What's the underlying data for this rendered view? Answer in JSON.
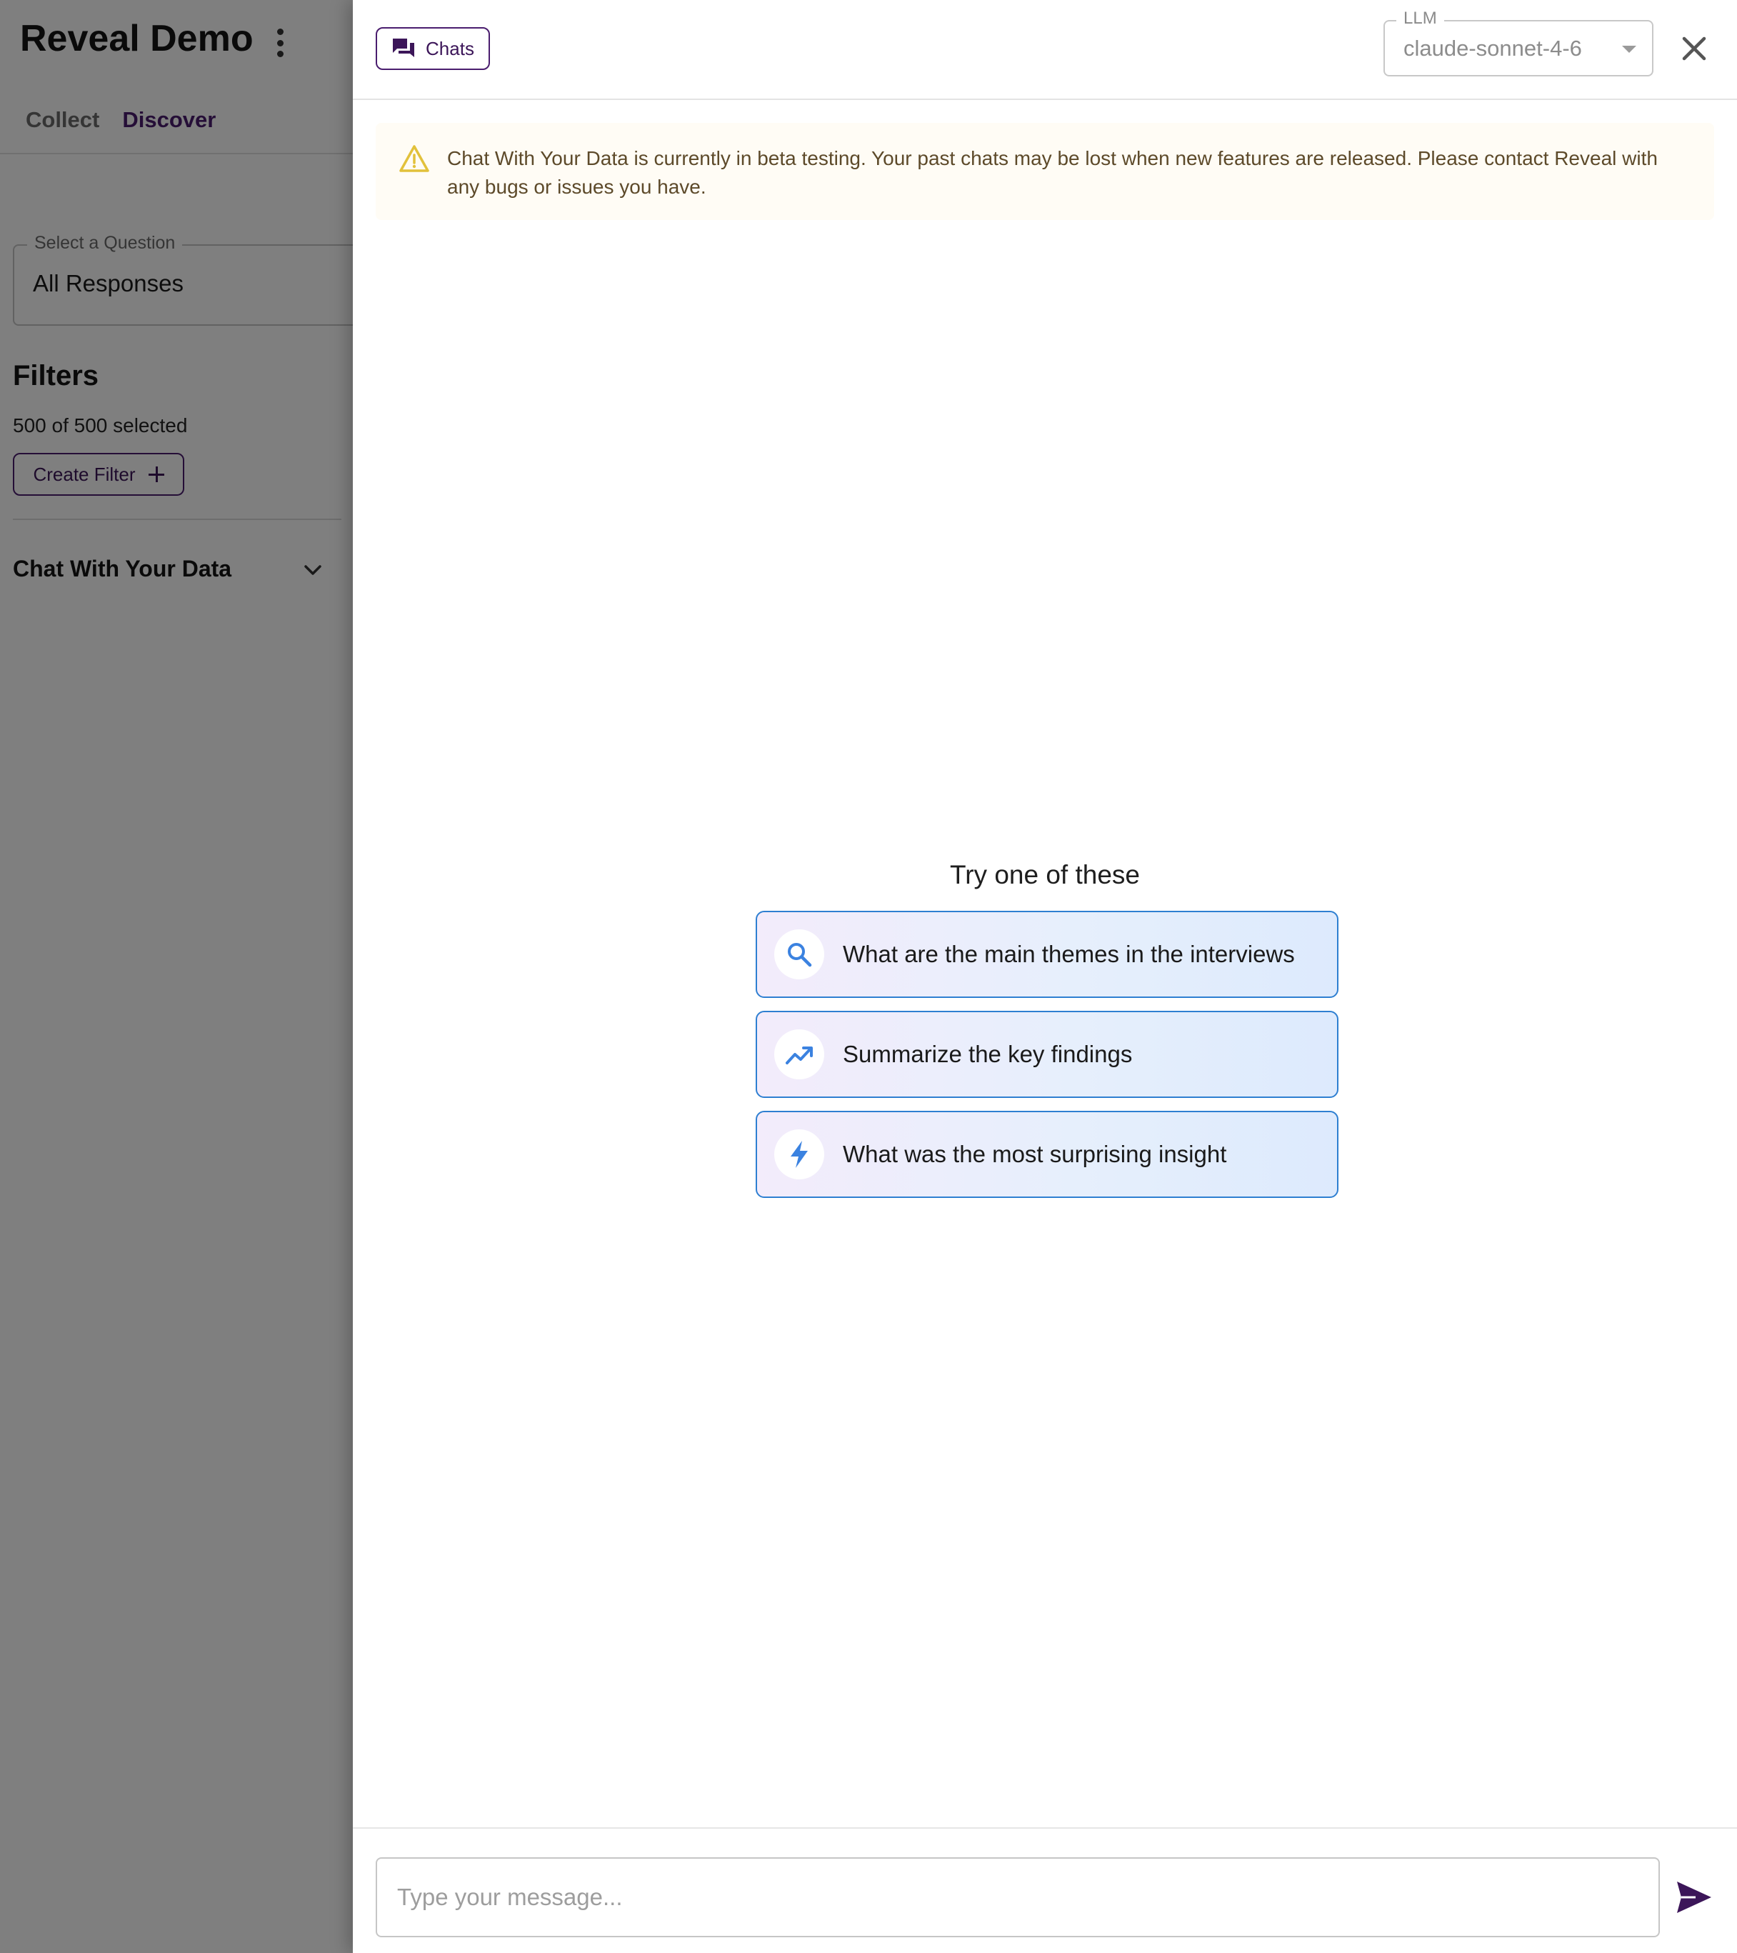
{
  "app": {
    "title": "Reveal Demo",
    "tabs": [
      {
        "label": "Collect"
      },
      {
        "label": "Discover"
      }
    ],
    "question_select": {
      "label": "Select a Question",
      "value": "All Responses"
    },
    "filters": {
      "title": "Filters",
      "count": "500 of 500 selected",
      "create_label": "Create Filter"
    },
    "chat_section_title": "Chat With Your Data"
  },
  "drawer": {
    "chats_label": "Chats",
    "llm": {
      "label": "LLM",
      "value": "claude-sonnet-4-6"
    },
    "beta_notice": "Chat With Your Data is currently in beta testing. Your past chats may be lost when new features are released. Please contact Reveal with any bugs or issues you have.",
    "suggestions_title": "Try one of these",
    "suggestions": [
      {
        "label": "What are the main themes in the interviews",
        "icon": "search-icon"
      },
      {
        "label": "Summarize the key findings",
        "icon": "trending-up-icon"
      },
      {
        "label": "What was the most surprising insight",
        "icon": "bolt-icon"
      }
    ],
    "message_placeholder": "Type your message..."
  },
  "colors": {
    "brand": "#4a1d6e",
    "suggestion_border": "#2e7fd1",
    "icon_blue": "#3b82e0",
    "warning": "#e2c13b"
  }
}
